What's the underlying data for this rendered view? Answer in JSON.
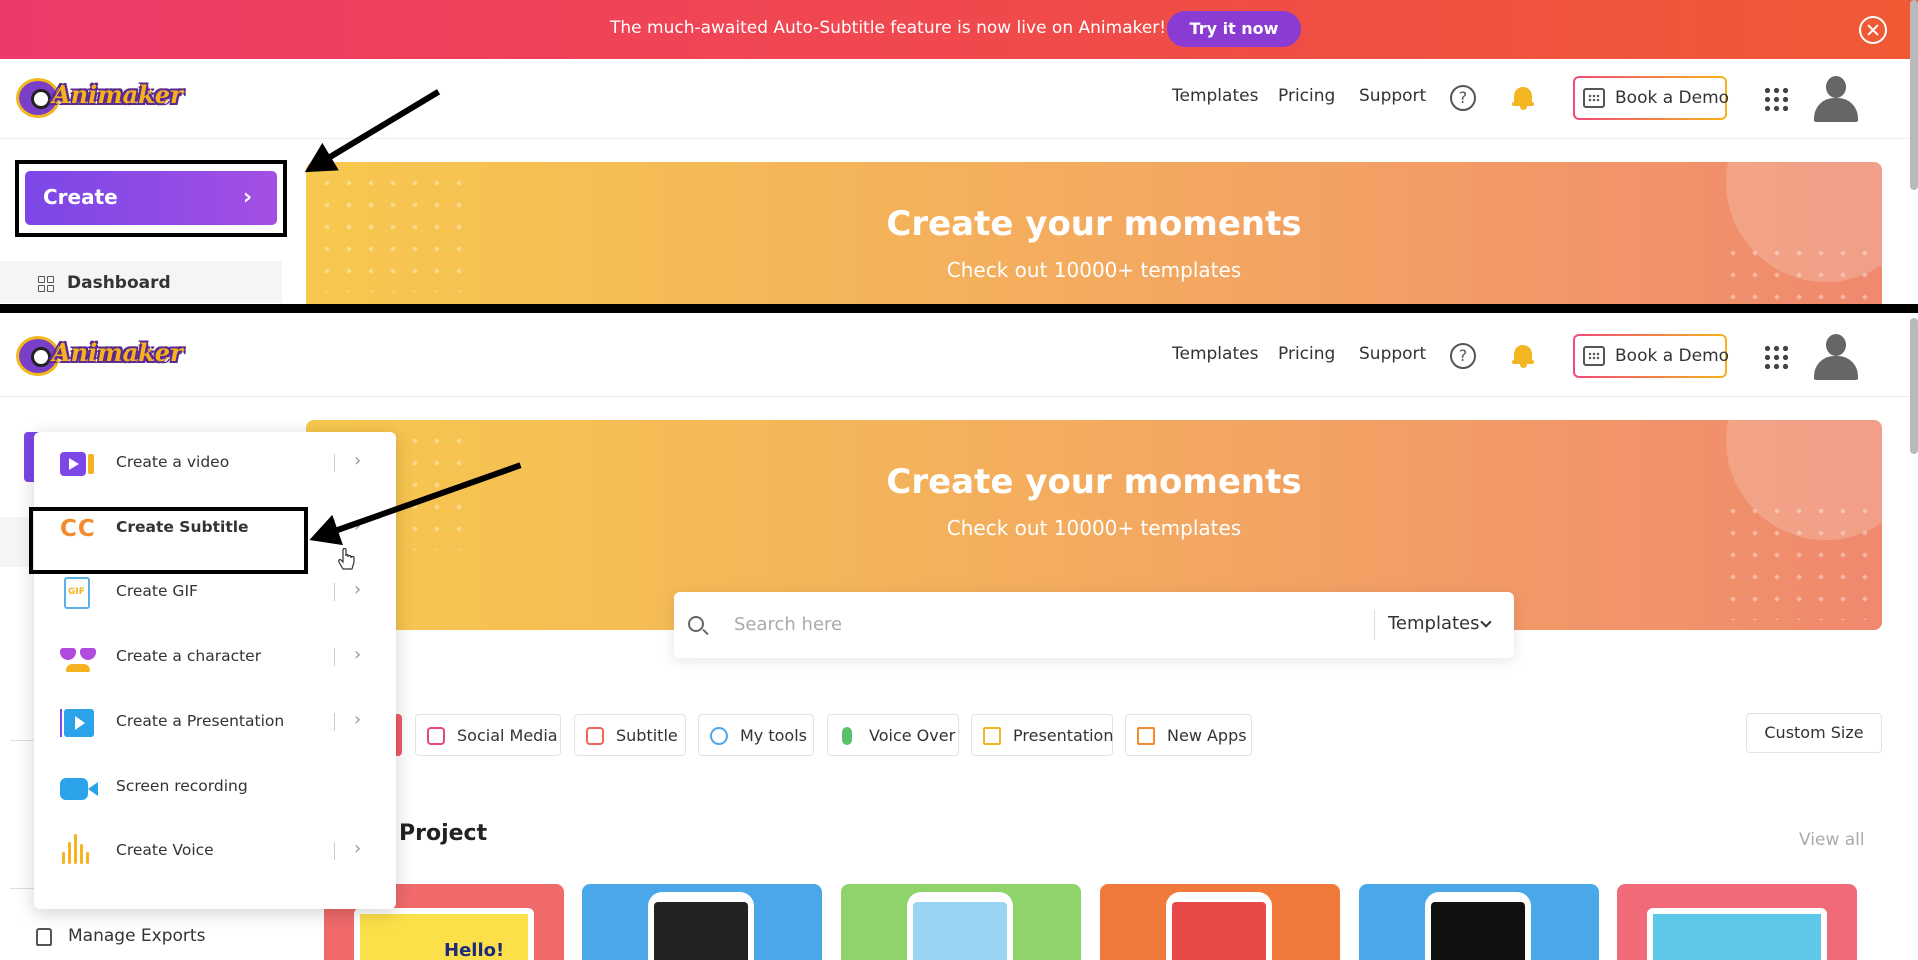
{
  "banner": {
    "text": "The much-awaited Auto-Subtitle feature is now live on Animaker!",
    "cta_label": "Try it now"
  },
  "header": {
    "logo_text": "Animaker",
    "nav": [
      "Templates",
      "Pricing",
      "Support"
    ],
    "help_glyph": "?",
    "demo_label": "Book a Demo"
  },
  "hero": {
    "title": "Create your moments",
    "subtitle": "Check out 10000+ templates"
  },
  "sidebar": {
    "create_label": "Create",
    "dashboard_label": "Dashboard",
    "manage_exports_label": "Manage Exports"
  },
  "create_menu": {
    "items": [
      {
        "label": "Create a video",
        "icon": "video-icon"
      },
      {
        "label": "Create Subtitle",
        "icon": "cc-icon",
        "active": true
      },
      {
        "label": "Create GIF",
        "icon": "gif-icon"
      },
      {
        "label": "Create a character",
        "icon": "character-icon"
      },
      {
        "label": "Create a Presentation",
        "icon": "presentation-icon"
      },
      {
        "label": "Screen recording",
        "icon": "screen-recording-icon"
      },
      {
        "label": "Create Voice",
        "icon": "voice-icon"
      }
    ]
  },
  "search": {
    "placeholder": "Search here",
    "category": "Templates"
  },
  "chips": [
    {
      "label": "Social Media",
      "color": "#e8457a"
    },
    {
      "label": "Subtitle",
      "color": "#f0645a"
    },
    {
      "label": "My tools",
      "color": "#4aa8e8"
    },
    {
      "label": "Voice Over",
      "color": "#5bbf6a"
    },
    {
      "label": "Presentation",
      "color": "#f6b21f"
    },
    {
      "label": "New Apps",
      "color": "#f38b2c"
    }
  ],
  "custom_size_label": "Custom Size",
  "projects": {
    "title": "Project",
    "view_all_label": "View all",
    "card_colors": [
      "#f06a6a",
      "#4aa8e8",
      "#8ed46a",
      "#f07a3a",
      "#4aa8e8",
      "#f06a7a"
    ],
    "hello_text": "Hello!"
  },
  "colors": {
    "accent": "#7b47e6",
    "banner_start": "#ee3a6a",
    "banner_end": "#ef5a34"
  }
}
